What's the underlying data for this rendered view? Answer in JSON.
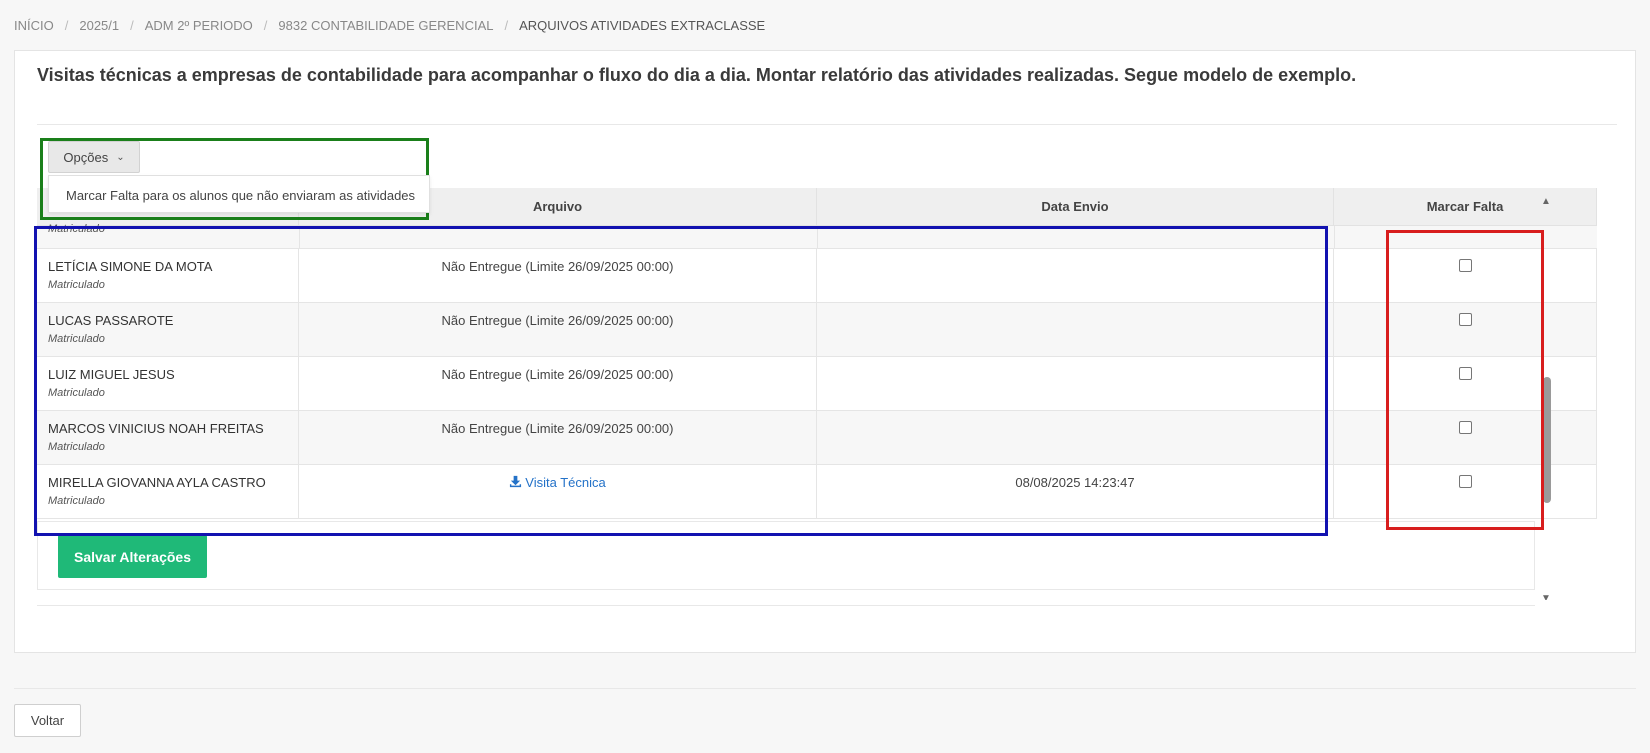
{
  "breadcrumb": [
    "INÍCIO",
    "2025/1",
    "ADM 2º PERIODO",
    "9832 CONTABILIDADE GERENCIAL",
    "ARQUIVOS ATIVIDADES EXTRACLASSE"
  ],
  "description": "Visitas técnicas a empresas de contabilidade para acompanhar o fluxo do dia a dia. Montar relatório das atividades realizadas. Segue modelo de exemplo.",
  "options_button": "Opções",
  "dropdown_item": "Marcar Falta para os alunos que não enviaram as atividades",
  "table": {
    "columns": [
      "",
      "Arquivo",
      "Data Envio",
      "Marcar Falta"
    ],
    "partial_row_status": "Matriculado",
    "rows": [
      {
        "name": "LETÍCIA SIMONE DA MOTA",
        "status": "Matriculado",
        "arquivo": "Não Entregue (Limite 26/09/2025 00:00)",
        "data_envio": "",
        "checked": false
      },
      {
        "name": "LUCAS PASSAROTE",
        "status": "Matriculado",
        "arquivo": "Não Entregue (Limite 26/09/2025 00:00)",
        "data_envio": "",
        "checked": false
      },
      {
        "name": "LUIZ MIGUEL JESUS",
        "status": "Matriculado",
        "arquivo": "Não Entregue (Limite 26/09/2025 00:00)",
        "data_envio": "",
        "checked": false
      },
      {
        "name": "MARCOS VINICIUS NOAH FREITAS",
        "status": "Matriculado",
        "arquivo": "Não Entregue (Limite 26/09/2025 00:00)",
        "data_envio": "",
        "checked": false
      },
      {
        "name": "MIRELLA GIOVANNA AYLA CASTRO",
        "status": "Matriculado",
        "arquivo": "Visita Técnica",
        "data_envio": "08/08/2025 14:23:47",
        "checked": false
      }
    ]
  },
  "save_button": "Salvar Alterações",
  "back_button": "Voltar",
  "colors": {
    "save": "#1fb978",
    "link": "#2472c8",
    "annot_green": "#1a7f1a",
    "annot_blue": "#1212b0",
    "annot_red": "#d81e1e"
  }
}
